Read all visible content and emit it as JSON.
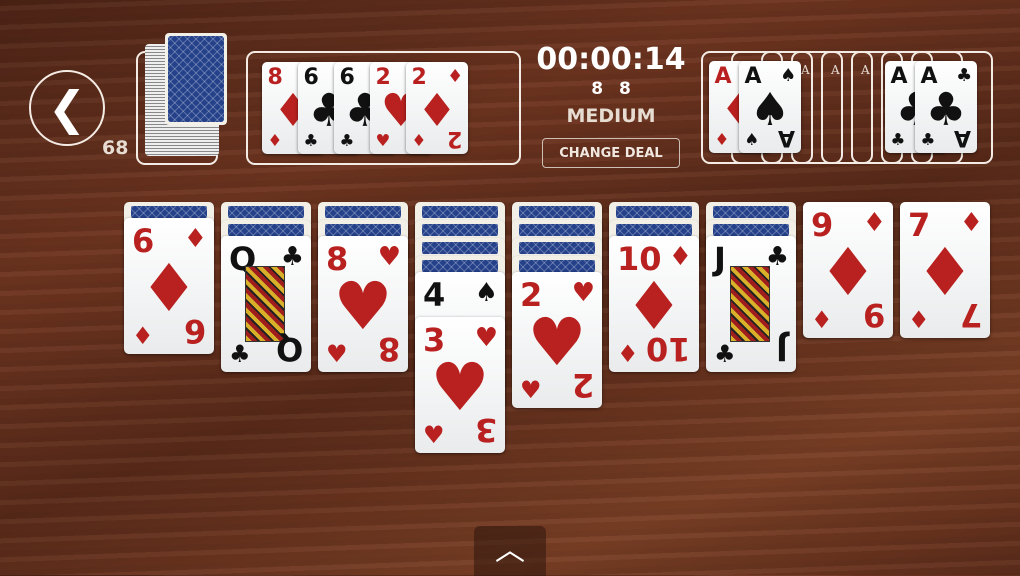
{
  "header": {
    "back_icon": "chevron-left-icon",
    "stock_count": "68",
    "timer": "00:00:14",
    "moves": "8 8",
    "difficulty": "MEDIUM",
    "change_deal_label": "CHANGE DEAL"
  },
  "colors": {
    "red": "#b8211f",
    "black": "#111111",
    "card_back": "#24418a"
  },
  "waste": [
    {
      "rank": "8",
      "suit": "diamonds"
    },
    {
      "rank": "6",
      "suit": "clubs"
    },
    {
      "rank": "6",
      "suit": "clubs"
    },
    {
      "rank": "2",
      "suit": "hearts"
    },
    {
      "rank": "2",
      "suit": "diamonds"
    }
  ],
  "foundations": [
    {
      "rank": "A",
      "suit": "diamonds"
    },
    {
      "rank": "A",
      "suit": "spades"
    },
    {
      "empty_label": "A"
    },
    {
      "empty_label": "A"
    },
    {
      "empty_label": "A"
    },
    {
      "empty_label": "A"
    },
    {
      "rank": "A",
      "suit": "clubs"
    },
    {
      "rank": "A",
      "suit": "clubs"
    }
  ],
  "tableau": [
    {
      "face_down": 1,
      "cards": [
        {
          "rank": "6",
          "suit": "diamonds"
        }
      ]
    },
    {
      "face_down": 2,
      "cards": [
        {
          "rank": "Q",
          "suit": "clubs"
        }
      ]
    },
    {
      "face_down": 2,
      "cards": [
        {
          "rank": "8",
          "suit": "hearts"
        }
      ]
    },
    {
      "face_down": 4,
      "cards": [
        {
          "rank": "4",
          "suit": "spades"
        },
        {
          "rank": "3",
          "suit": "hearts"
        }
      ]
    },
    {
      "face_down": 4,
      "cards": [
        {
          "rank": "2",
          "suit": "hearts"
        }
      ]
    },
    {
      "face_down": 2,
      "cards": [
        {
          "rank": "10",
          "suit": "diamonds"
        }
      ]
    },
    {
      "face_down": 2,
      "cards": [
        {
          "rank": "J",
          "suit": "clubs"
        }
      ]
    },
    {
      "face_down": 0,
      "cards": [
        {
          "rank": "9",
          "suit": "diamonds"
        }
      ]
    },
    {
      "face_down": 0,
      "cards": [
        {
          "rank": "7",
          "suit": "diamonds"
        }
      ]
    }
  ],
  "bottom": {
    "handle_icon": "chevron-up-icon"
  }
}
